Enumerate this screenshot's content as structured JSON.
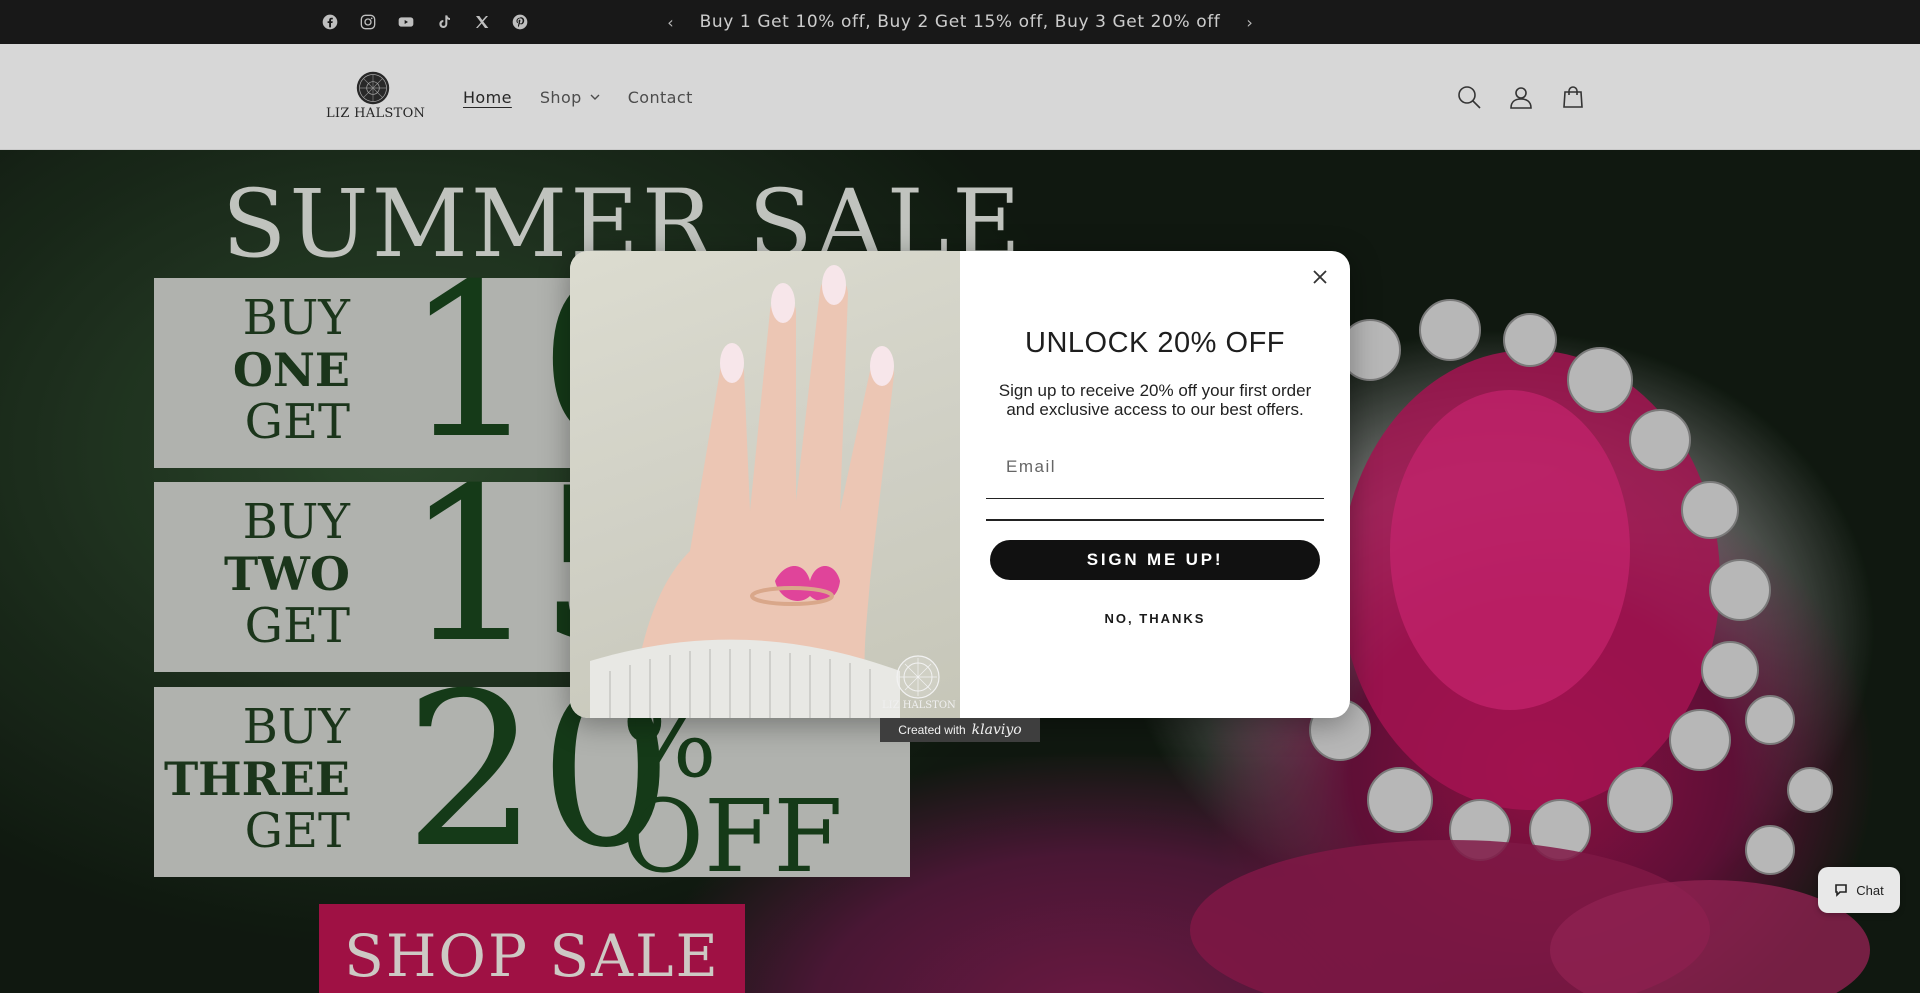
{
  "announcement": {
    "text": "Buy 1 Get 10% off, Buy 2 Get 15% off, Buy 3 Get 20% off",
    "prev_icon": "chevron-left-icon",
    "next_icon": "chevron-right-icon"
  },
  "socials": [
    "facebook-icon",
    "instagram-icon",
    "youtube-icon",
    "tiktok-icon",
    "x-icon",
    "pinterest-icon"
  ],
  "header": {
    "logo_text": "LIZ HALSTON",
    "nav": [
      {
        "label": "Home",
        "active": true
      },
      {
        "label": "Shop",
        "has_dropdown": true
      },
      {
        "label": "Contact"
      }
    ],
    "icons": [
      "search-icon",
      "account-icon",
      "cart-icon"
    ]
  },
  "hero": {
    "title": "SUMMER SALE",
    "offers": [
      {
        "line1": "BUY",
        "line2": "ONE",
        "line3": "GET",
        "percent": "10"
      },
      {
        "line1": "BUY",
        "line2": "TWO",
        "line3": "GET",
        "percent": "15"
      },
      {
        "line1": "BUY",
        "line2": "THREE",
        "line3": "GET",
        "percent": "20",
        "pct_sign": "%",
        "off": "OFF"
      }
    ],
    "cta": "SHOP SALE"
  },
  "modal": {
    "title": "UNLOCK 20% OFF",
    "subtitle": "Sign up to receive 20% off your first order and exclusive access to our best offers.",
    "email_placeholder": "Email",
    "signup_label": "SIGN ME UP!",
    "decline_label": "NO, THANKS",
    "image_logo_text": "LIZ HALSTON",
    "close_icon": "close-icon"
  },
  "badge": {
    "prefix": "Created with",
    "brand": "klaviyo"
  },
  "chat": {
    "label": "Chat"
  },
  "colors": {
    "announcement_bg": "#1a1a1a",
    "header_bg": "#f3f3f3",
    "sale_green": "#16401a",
    "cta_pink": "#b3124c",
    "button_black": "#111111"
  }
}
